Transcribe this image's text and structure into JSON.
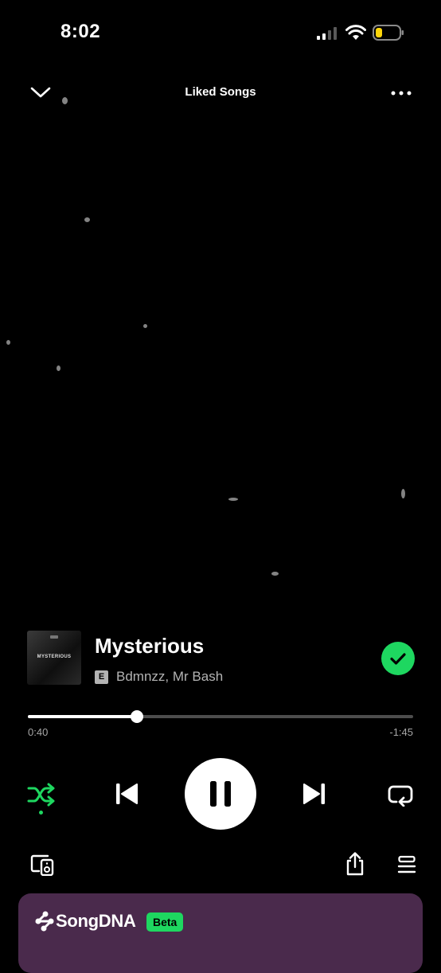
{
  "status_bar": {
    "time": "8:02"
  },
  "header": {
    "title": "Liked Songs"
  },
  "track": {
    "title": "Mysterious",
    "explicit_badge": "E",
    "artists": "Bdmnzz, Mr Bash",
    "cover_text": "MYSTERIOUS",
    "liked": true
  },
  "progress": {
    "elapsed": "0:40",
    "remaining": "-1:45",
    "fraction": 0.284
  },
  "controls": {
    "shuffle_active": true,
    "playing": true
  },
  "songdna": {
    "title": "SongDNA",
    "badge": "Beta"
  },
  "colors": {
    "accent": "#1ed760",
    "background": "#000000",
    "songdna_bg": "#4a2a4c",
    "secondary_text": "#b3b3b3"
  },
  "icons": [
    "chevron-down-icon",
    "more-icon",
    "signal-icon",
    "wifi-icon",
    "battery-icon",
    "check-icon",
    "shuffle-icon",
    "previous-icon",
    "pause-icon",
    "next-icon",
    "repeat-icon",
    "devices-icon",
    "share-icon",
    "queue-icon",
    "songdna-logo-icon"
  ]
}
